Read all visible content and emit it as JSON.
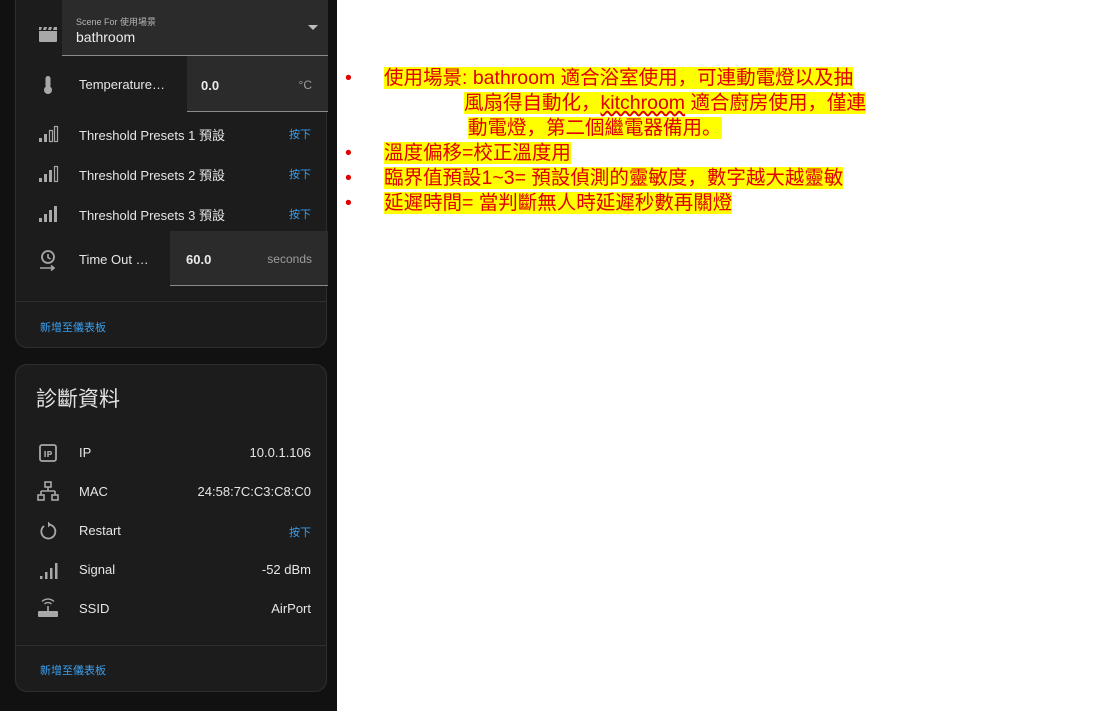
{
  "settings_card": {
    "scene": {
      "label": "Scene For 使用場景",
      "value": "bathroom"
    },
    "temperature": {
      "label": "Temperature…",
      "value": "0.0",
      "unit": "°C"
    },
    "presets": [
      {
        "label": "Threshold Presets 1 預設",
        "action": "按下",
        "icon": "signal-1-bar-icon"
      },
      {
        "label": "Threshold Presets 2 預設",
        "action": "按下",
        "icon": "signal-2-bar-icon"
      },
      {
        "label": "Threshold Presets 3 預設",
        "action": "按下",
        "icon": "signal-3-bar-icon"
      }
    ],
    "timeout": {
      "label": "Time Out …",
      "value": "60.0",
      "unit": "seconds"
    },
    "add_to_dashboard": "新增至儀表板"
  },
  "diagnostics_card": {
    "title": "診斷資料",
    "rows": [
      {
        "label": "IP",
        "value": "10.0.1.106",
        "icon": "ip-icon"
      },
      {
        "label": "MAC",
        "value": "24:58:7C:C3:C8:C0",
        "icon": "network-icon"
      },
      {
        "label": "Restart",
        "value": "按下",
        "icon": "restart-icon"
      },
      {
        "label": "Signal",
        "value": "-52 dBm",
        "icon": "signal-icon"
      },
      {
        "label": "SSID",
        "value": "AirPort",
        "icon": "router-icon"
      }
    ],
    "add_to_dashboard": "新增至儀表板"
  },
  "notes": {
    "n1_a": "使用場景: bathroom 適合浴室使用，可連動電燈以及抽",
    "n1_b": "風扇得自動化，",
    "n1_c": "kitchroom",
    "n1_d": " 適合廚房使用，僅連",
    "n1_e": "動電燈，第二個繼電器備用。",
    "n2": "溫度偏移=校正溫度用",
    "n3": "臨界值預設1~3= 預設偵測的靈敏度，數字越大越靈敏",
    "n4": "延遲時間= 當判斷無人時延遲秒數再關燈",
    "bullet": "•"
  },
  "colors": {
    "accent": "#3aa0f0",
    "highlight": "#ffff00",
    "note_text": "#e00000",
    "card_bg": "#1c1c1c"
  }
}
